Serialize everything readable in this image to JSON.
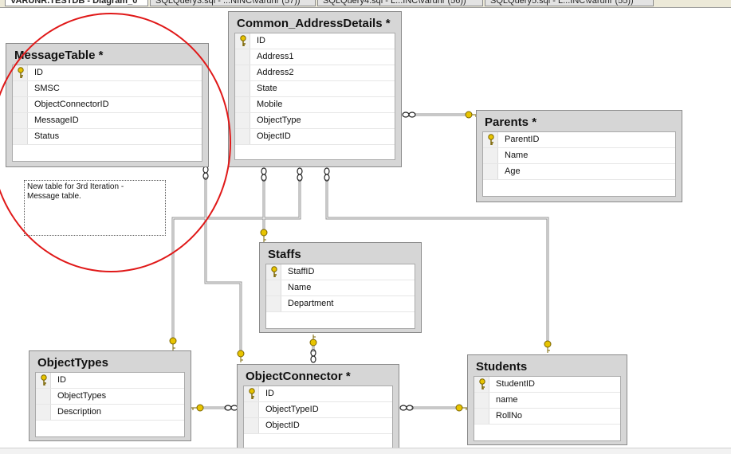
{
  "tabs": [
    {
      "label": "VARUNR.TESTDB - Diagram_0",
      "active": true
    },
    {
      "label": "SQLQuery3.sql - ...NINC\\varunr (57))",
      "active": false
    },
    {
      "label": "SQLQuery4.sql - L...INC\\varunr (56))",
      "active": false
    },
    {
      "label": "SQLQuery5.sql - L...INC\\varunr (55))",
      "active": false
    }
  ],
  "tables": {
    "message_table": {
      "title": "MessageTable *",
      "columns": [
        "ID",
        "SMSC",
        "ObjectConnectorID",
        "MessageID",
        "Status"
      ],
      "primary_key": "ID"
    },
    "common_address_details": {
      "title": "Common_AddressDetails *",
      "columns": [
        "ID",
        "Address1",
        "Address2",
        "State",
        "Mobile",
        "ObjectType",
        "ObjectID"
      ],
      "primary_key": "ID"
    },
    "parents": {
      "title": "Parents *",
      "columns": [
        "ParentID",
        "Name",
        "Age"
      ],
      "primary_key": "ParentID"
    },
    "staffs": {
      "title": "Staffs",
      "columns": [
        "StaffID",
        "Name",
        "Department"
      ],
      "primary_key": "StaffID"
    },
    "object_types": {
      "title": "ObjectTypes",
      "columns": [
        "ID",
        "ObjectTypes",
        "Description"
      ],
      "primary_key": "ID"
    },
    "object_connector": {
      "title": "ObjectConnector *",
      "columns": [
        "ID",
        "ObjectTypeID",
        "ObjectID"
      ],
      "primary_key": "ID"
    },
    "students": {
      "title": "Students",
      "columns": [
        "StudentID",
        "name",
        "RollNo"
      ],
      "primary_key": "StudentID"
    }
  },
  "annotation": {
    "text": "New table for 3rd Iteration -\nMessage table."
  },
  "colors": {
    "highlight_circle": "#e01818",
    "table_header": "#d6d6d6",
    "key_icon": "#e8c400"
  },
  "icons": {
    "primary_key": "key-icon",
    "many_end": "infinity-icon",
    "one_end": "key-icon"
  }
}
